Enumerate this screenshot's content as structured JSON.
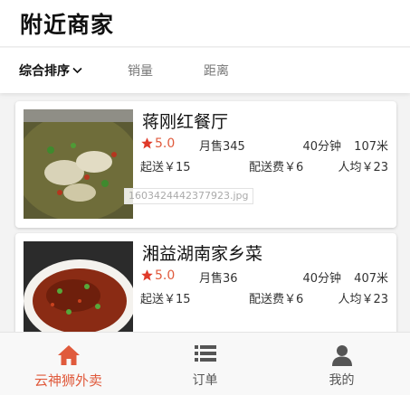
{
  "page": {
    "title": "附近商家"
  },
  "sort": {
    "items": [
      {
        "label": "综合排序",
        "active": true
      },
      {
        "label": "销量",
        "active": false
      },
      {
        "label": "距离",
        "active": false
      }
    ]
  },
  "shops": [
    {
      "name": "蒋刚红餐厅",
      "rating": "5.0",
      "sales": "月售345",
      "eta": "40分钟",
      "distance": "107米",
      "min_order": "起送￥15",
      "delivery_fee": "配送费￥6",
      "avg_price": "人均￥23",
      "image_caption": "1603424442377923.jpg"
    },
    {
      "name": "湘益湖南家乡菜",
      "rating": "5.0",
      "sales": "月售36",
      "eta": "40分钟",
      "distance": "407米",
      "min_order": "起送￥15",
      "delivery_fee": "配送费￥6",
      "avg_price": "人均￥23"
    }
  ],
  "tabbar": {
    "items": [
      {
        "label": "云神狮外卖",
        "icon": "home-icon",
        "active": true
      },
      {
        "label": "订单",
        "icon": "list-icon",
        "active": false
      },
      {
        "label": "我的",
        "icon": "user-icon",
        "active": false
      }
    ]
  },
  "colors": {
    "accent": "#e05a3c",
    "star": "#e03a2a"
  }
}
